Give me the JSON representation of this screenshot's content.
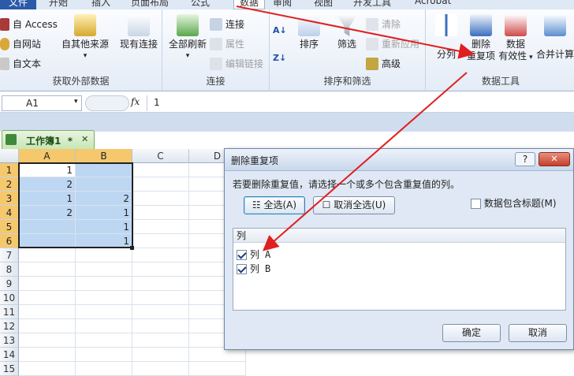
{
  "tabs": [
    "文件",
    "开始",
    "插入",
    "页面布局",
    "公式",
    "数据",
    "审阅",
    "视图",
    "开发工具",
    "Acrobat"
  ],
  "ribbon": {
    "get_external": {
      "label": "获取外部数据",
      "access": "自 Access",
      "web": "自网站",
      "text": "自文本",
      "other": "自其他来源",
      "existing": "现有连接"
    },
    "connections": {
      "label": "连接",
      "refresh": "全部刷新",
      "conn": "连接",
      "props": "属性",
      "edit_links": "编辑链接"
    },
    "sort_filter": {
      "label": "排序和筛选",
      "sort": "排序",
      "filter": "筛选",
      "clear": "清除",
      "reapply": "重新应用",
      "advanced": "高级"
    },
    "data_tools": {
      "label": "数据工具",
      "split": "分列",
      "remove_dup_1": "删除",
      "remove_dup_2": "重复项",
      "validation_1": "数据",
      "validation_2": "有效性",
      "consolidate": "合并计算"
    }
  },
  "formula_bar": {
    "name_box": "A1",
    "fx": "fx",
    "value": "1"
  },
  "workbook_tab": {
    "title": "工作簿1  *",
    "close": "✕"
  },
  "sheet": {
    "columns": [
      "A",
      "B",
      "C",
      "D"
    ],
    "rows": [
      "1",
      "2",
      "3",
      "4",
      "5",
      "6",
      "7",
      "8",
      "9",
      "10",
      "11",
      "12",
      "13",
      "14",
      "15"
    ],
    "cells": [
      [
        "1",
        ""
      ],
      [
        "2",
        ""
      ],
      [
        "1",
        "2"
      ],
      [
        "2",
        "1"
      ],
      [
        "",
        "1"
      ],
      [
        "",
        "1"
      ]
    ]
  },
  "dialog": {
    "title": "删除重复项",
    "help": "?",
    "close": "✕",
    "instruction": "若要删除重复值，请选择一个或多个包含重复值的列。",
    "select_all": "全选(A)",
    "unselect_all": "取消全选(U)",
    "has_headers": "数据包含标题(M)",
    "list_header": "列",
    "columns": [
      "列 A",
      "列 B"
    ],
    "ok": "确定",
    "cancel": "取消"
  },
  "colors": {
    "arrow": "#e02020",
    "selection": "#bdd7f3",
    "file_tab": "#2a5aa8"
  }
}
